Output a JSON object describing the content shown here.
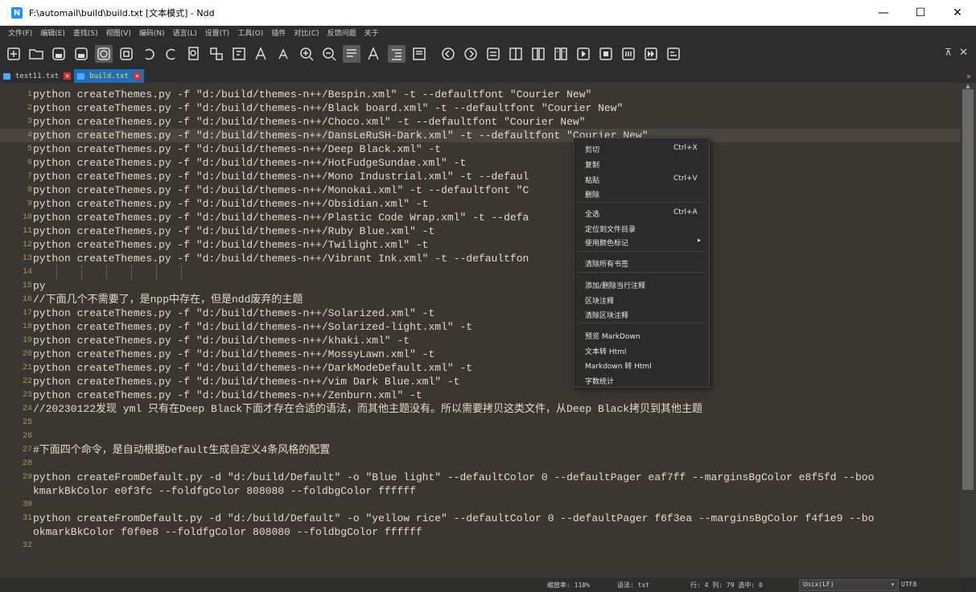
{
  "window": {
    "title": "F:\\automail\\build\\build.txt [文本模式] - Ndd",
    "minimize": "—",
    "maximize": "☐",
    "close": "✕"
  },
  "menubar": [
    "文件(F)",
    "编辑(E)",
    "查找(S)",
    "视图(V)",
    "编码(N)",
    "语言(L)",
    "设置(T)",
    "工具(O)",
    "插件",
    "对比(C)",
    "反馈问题",
    "关于"
  ],
  "toolbar": {
    "icons": [
      "new-file-icon",
      "open-folder-icon",
      "save-icon",
      "save-all-icon",
      "close-doc-icon",
      "close-all-icon",
      "undo-icon",
      "redo-icon",
      "find-icon",
      "replace-icon",
      "find-in-dir-icon",
      "zoom-font-up-icon",
      "zoom-font-down-icon",
      "zoom-in-icon",
      "zoom-out-icon",
      "wrap-icon",
      "show-whitespace-icon",
      "indent-guide-icon",
      "preview-icon",
      "prev-icon",
      "next-icon",
      "doc-icon",
      "panel-icon",
      "compare-file-icon",
      "compare-dir-icon",
      "macro-play-icon",
      "macro-stop-icon",
      "macro-record-icon",
      "macro-run-multi-icon",
      "save-macro-icon"
    ],
    "pin": "⊼",
    "close": "✕"
  },
  "tabs": [
    {
      "label": "test11.txt",
      "active": false
    },
    {
      "label": "build.txt",
      "active": true
    }
  ],
  "editor": {
    "current_line": 4,
    "lines": [
      {
        "n": "1",
        "text": "python createThemes.py -f \"d:/build/themes-n++/Bespin.xml\" -t --defaultfont \"Courier New\""
      },
      {
        "n": "2",
        "text": "python createThemes.py -f \"d:/build/themes-n++/Black board.xml\" -t --defaultfont \"Courier New\""
      },
      {
        "n": "3",
        "text": "python createThemes.py -f \"d:/build/themes-n++/Choco.xml\" -t --defaultfont \"Courier New\""
      },
      {
        "n": "4",
        "text": "python createThemes.py -f \"d:/build/themes-n++/DansLeRuSH-Dark.xml\" -t --defaultfont \"Courier New\""
      },
      {
        "n": "5",
        "text": "python createThemes.py -f \"d:/build/themes-n++/Deep Black.xml\" -t"
      },
      {
        "n": "6",
        "text": "python createThemes.py -f \"d:/build/themes-n++/HotFudgeSundae.xml\" -t"
      },
      {
        "n": "7",
        "text": "python createThemes.py -f \"d:/build/themes-n++/Mono Industrial.xml\" -t --defaul"
      },
      {
        "n": "8",
        "text": "python createThemes.py -f \"d:/build/themes-n++/Monokai.xml\" -t --defaultfont \"C"
      },
      {
        "n": "9",
        "text": "python createThemes.py -f \"d:/build/themes-n++/Obsidian.xml\" -t"
      },
      {
        "n": "10",
        "text": "python createThemes.py -f \"d:/build/themes-n++/Plastic Code Wrap.xml\" -t --defa"
      },
      {
        "n": "11",
        "text": "python createThemes.py -f \"d:/build/themes-n++/Ruby Blue.xml\" -t"
      },
      {
        "n": "12",
        "text": "python createThemes.py -f \"d:/build/themes-n++/Twilight.xml\" -t"
      },
      {
        "n": "13",
        "text": "python createThemes.py -f \"d:/build/themes-n++/Vibrant Ink.xml\" -t --defaultfon"
      },
      {
        "n": "14",
        "text": ""
      },
      {
        "n": "15",
        "text": "py"
      },
      {
        "n": "16",
        "text": "//下面几个不需要了，是npp中存在，但是ndd废弃的主题"
      },
      {
        "n": "17",
        "text": "python createThemes.py -f \"d:/build/themes-n++/Solarized.xml\" -t"
      },
      {
        "n": "18",
        "text": "python createThemes.py -f \"d:/build/themes-n++/Solarized-light.xml\" -t"
      },
      {
        "n": "19",
        "text": "python createThemes.py -f \"d:/build/themes-n++/khaki.xml\" -t"
      },
      {
        "n": "20",
        "text": "python createThemes.py -f \"d:/build/themes-n++/MossyLawn.xml\" -t"
      },
      {
        "n": "21",
        "text": "python createThemes.py -f \"d:/build/themes-n++/DarkModeDefault.xml\" -t"
      },
      {
        "n": "22",
        "text": "python createThemes.py -f \"d:/build/themes-n++/vim Dark Blue.xml\" -t"
      },
      {
        "n": "23",
        "text": "python createThemes.py -f \"d:/build/themes-n++/Zenburn.xml\" -t"
      },
      {
        "n": "24",
        "text": "//20230122发现 yml 只有在Deep Black下面才存在合适的语法，而其他主题没有。所以需要拷贝这类文件，从Deep Black拷贝到其他主题"
      },
      {
        "n": "25",
        "text": ""
      },
      {
        "n": "26",
        "text": ""
      },
      {
        "n": "27",
        "text": "#下面四个命令，是自动根据Default生成自定义4条风格的配置"
      },
      {
        "n": "28",
        "text": ""
      },
      {
        "n": "29",
        "text": "python createFromDefault.py -d \"d:/build/Default\" -o \"Blue light\" --defaultColor 0 --defaultPager eaf7ff --marginsBgColor e8f5fd --boo"
      },
      {
        "n": "",
        "text": "kmarkBkColor e0f3fc --foldfgColor 808080 --foldbgColor ffffff"
      },
      {
        "n": "30",
        "text": ""
      },
      {
        "n": "31",
        "text": "python createFromDefault.py -d \"d:/build/Default\" -o \"yellow rice\" --defaultColor 0 --defaultPager f6f3ea --marginsBgColor f4f1e9 --bo"
      },
      {
        "n": "",
        "text": "okmarkBkColor f0f0e8 --foldfgColor 808080 --foldbgColor ffffff"
      },
      {
        "n": "32",
        "text": ""
      }
    ]
  },
  "context_menu": {
    "items": [
      {
        "label": "剪切",
        "shortcut": "Ctrl+X"
      },
      {
        "label": "复制",
        "shortcut": ""
      },
      {
        "label": "粘贴",
        "shortcut": "Ctrl+V"
      },
      {
        "label": "删除",
        "shortcut": ""
      },
      {
        "label": "全选",
        "shortcut": "Ctrl+A"
      },
      {
        "label": "定位到文件目录",
        "shortcut": ""
      },
      {
        "label": "使用颜色标记",
        "shortcut": "",
        "submenu": true
      },
      {
        "label": "清除所有书签",
        "shortcut": ""
      },
      {
        "label": "添加/删除当行注释",
        "shortcut": ""
      },
      {
        "label": "区块注释",
        "shortcut": ""
      },
      {
        "label": "清除区块注释",
        "shortcut": ""
      },
      {
        "label": "预览 MarkDown",
        "shortcut": ""
      },
      {
        "label": "文本转 Html",
        "shortcut": ""
      },
      {
        "label": "Markdown 转 Html",
        "shortcut": ""
      },
      {
        "label": "字数统计",
        "shortcut": ""
      }
    ]
  },
  "statusbar": {
    "zoom": "缩放率: 110%",
    "lang": "语法: txt",
    "pos": "行: 4 列: 79 选中: 0",
    "eol": "Unix(LF)",
    "encoding": "UTF8"
  },
  "colors": {
    "editor_bg": "#3a3631",
    "current_line_bg": "#4a4540",
    "text": "#e2dbcd",
    "line_number": "#b3935b",
    "active_tab": "#1d6fb8"
  }
}
